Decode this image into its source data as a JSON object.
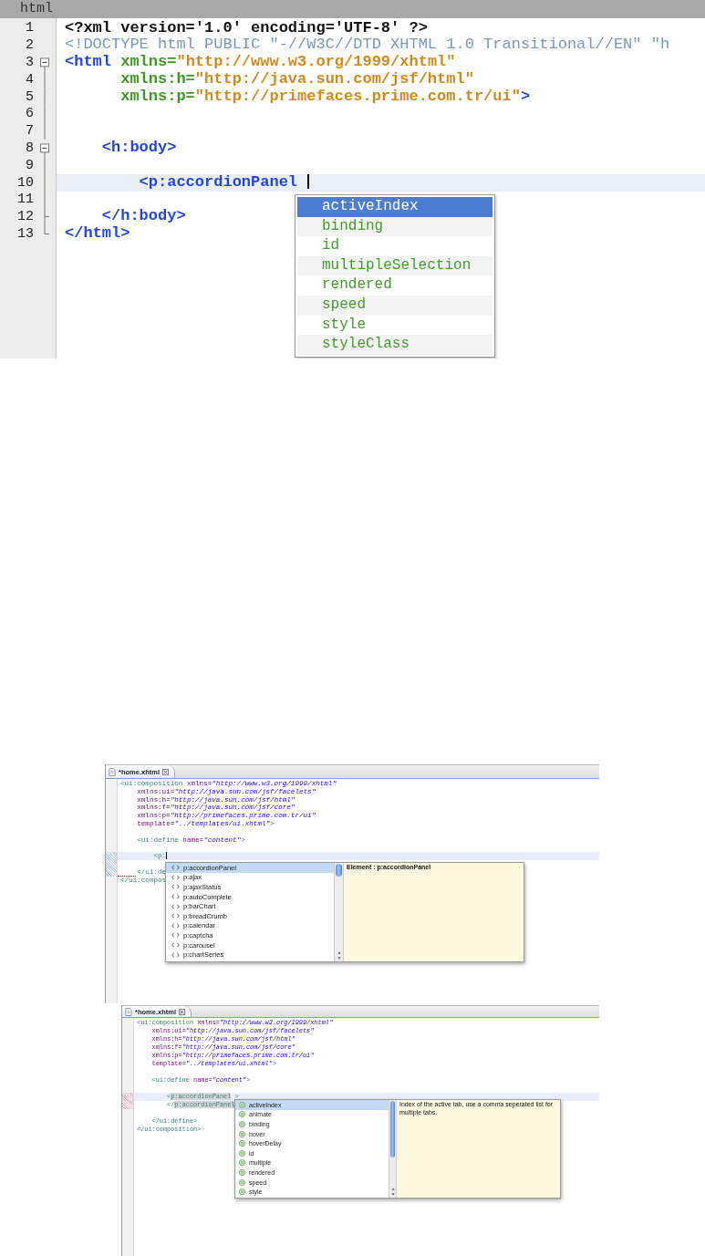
{
  "editors": [
    {
      "kind": "netbeans",
      "title": "html",
      "lines": [
        {
          "number": "1",
          "kind": "plain",
          "current": false,
          "tokens": [
            {
              "kind": "decl",
              "text": "<?xml version='1.0' encoding='UTF-8' ?>"
            }
          ]
        },
        {
          "number": "2",
          "kind": "plain",
          "current": false,
          "tokens": [
            {
              "kind": "doctype",
              "text": "<!DOCTYPE html PUBLIC \"-//W3C//DTD XHTML 1.0 Transitional//EN\" \"h"
            }
          ]
        },
        {
          "number": "3",
          "kind": "fold-start",
          "current": false,
          "tokens": [
            {
              "kind": "tag",
              "text": "<html"
            },
            {
              "kind": "attr",
              "text": " xmlns="
            },
            {
              "kind": "value",
              "text": "\"http://www.w3.org/1999/xhtml\""
            }
          ]
        },
        {
          "number": "4",
          "kind": "fold-line",
          "current": false,
          "tokens": [
            {
              "kind": "attr",
              "text": "      xmlns:h="
            },
            {
              "kind": "value",
              "text": "\"http://java.sun.com/jsf/html\""
            }
          ]
        },
        {
          "number": "5",
          "kind": "fold-line",
          "current": false,
          "tokens": [
            {
              "kind": "attr",
              "text": "      xmlns:p="
            },
            {
              "kind": "value",
              "text": "\"http://primefaces.prime.com.tr/ui\""
            },
            {
              "kind": "tag",
              "text": ">"
            }
          ]
        },
        {
          "number": "6",
          "kind": "fold-line",
          "current": false
        },
        {
          "number": "7",
          "kind": "fold-line",
          "current": false
        },
        {
          "number": "8",
          "kind": "fold-start",
          "current": false,
          "tokens": [
            {
              "kind": "tag",
              "text": "    <h:body>"
            }
          ]
        },
        {
          "number": "9",
          "kind": "fold-line",
          "current": false
        },
        {
          "number": "10",
          "kind": "fold-line",
          "current": true,
          "tokens": [
            {
              "kind": "tag",
              "text": "        <p:accordionPanel"
            },
            {
              "kind": "cursor"
            }
          ]
        },
        {
          "number": "11",
          "kind": "fold-line",
          "current": false
        },
        {
          "number": "12",
          "kind": "fold-tick",
          "current": false,
          "tokens": [
            {
              "kind": "tag",
              "text": "    </h:body>"
            }
          ]
        },
        {
          "number": "13",
          "kind": "fold-end",
          "current": false,
          "tokens": [
            {
              "kind": "tag",
              "text": "</html>"
            }
          ]
        }
      ],
      "popup": {
        "items": [
          {
            "label": "activeIndex",
            "selected": true
          },
          {
            "label": "binding",
            "selected": false
          },
          {
            "label": "id",
            "selected": false
          },
          {
            "label": "multipleSelection",
            "selected": false
          },
          {
            "label": "rendered",
            "selected": false
          },
          {
            "label": "speed",
            "selected": false
          },
          {
            "label": "style",
            "selected": false
          },
          {
            "label": "styleClass",
            "selected": false
          }
        ]
      }
    },
    {
      "kind": "eclipse",
      "tabs": [
        {
          "label": "*home.xhtml",
          "selected": true
        }
      ],
      "lines": [
        {
          "current": false,
          "marked": false,
          "error": false,
          "tokens": [
            {
              "kind": "tag",
              "text": "<ui:composition"
            },
            {
              "kind": "attr",
              "text": " xmlns"
            },
            {
              "kind": "plain",
              "text": "="
            },
            {
              "kind": "value",
              "text": "\"http://www.w3.org/1999/xhtml\""
            }
          ]
        },
        {
          "current": false,
          "marked": false,
          "error": false,
          "tokens": [
            {
              "kind": "attr",
              "text": "    xmlns:ui"
            },
            {
              "kind": "plain",
              "text": "="
            },
            {
              "kind": "value",
              "text": "\"http://java.sun.com/jsf/facelets\""
            }
          ]
        },
        {
          "current": false,
          "marked": false,
          "error": false,
          "tokens": [
            {
              "kind": "attr",
              "text": "    xmlns:h"
            },
            {
              "kind": "plain",
              "text": "="
            },
            {
              "kind": "value",
              "text": "\"http://java.sun.com/jsf/html\""
            }
          ]
        },
        {
          "current": false,
          "marked": false,
          "error": false,
          "tokens": [
            {
              "kind": "attr",
              "text": "    xmlns:f"
            },
            {
              "kind": "plain",
              "text": "="
            },
            {
              "kind": "value",
              "text": "\"http://java.sun.com/jsf/core\""
            }
          ]
        },
        {
          "current": false,
          "marked": false,
          "error": false,
          "tokens": [
            {
              "kind": "attr",
              "text": "    xmlns:p"
            },
            {
              "kind": "plain",
              "text": "="
            },
            {
              "kind": "value",
              "text": "\"http://primefaces.prime.com.tr/ui\""
            }
          ]
        },
        {
          "current": false,
          "marked": false,
          "error": false,
          "tokens": [
            {
              "kind": "attr",
              "text": "    template"
            },
            {
              "kind": "plain",
              "text": "="
            },
            {
              "kind": "value",
              "text": "\"../templates/ui.xhtml\""
            },
            {
              "kind": "tag",
              "text": ">"
            }
          ]
        },
        {
          "current": false,
          "marked": false,
          "error": false
        },
        {
          "current": false,
          "marked": false,
          "error": false,
          "tokens": [
            {
              "kind": "tag",
              "text": "    <ui:define"
            },
            {
              "kind": "attr",
              "text": " name"
            },
            {
              "kind": "plain",
              "text": "="
            },
            {
              "kind": "value",
              "text": "\"content\""
            },
            {
              "kind": "tag",
              "text": ">"
            }
          ]
        },
        {
          "current": false,
          "marked": false,
          "error": false
        },
        {
          "current": true,
          "marked": true,
          "error": false,
          "tokens": [
            {
              "kind": "tag",
              "text": "        <p:"
            },
            {
              "kind": "cursor"
            }
          ]
        },
        {
          "current": false,
          "marked": true,
          "error": false
        },
        {
          "current": false,
          "marked": true,
          "error": true,
          "tokens": [
            {
              "kind": "tag",
              "text": "    </ui:de"
            }
          ]
        },
        {
          "current": false,
          "marked": false,
          "error": false,
          "tokens": [
            {
              "kind": "tag",
              "text": "</ui:compos"
            }
          ]
        }
      ],
      "popup": {
        "description": "Element : p:accordionPanel",
        "items": [
          {
            "label": "p:accordionPanel",
            "kind": "element",
            "selected": true
          },
          {
            "label": "p:ajax",
            "kind": "element",
            "selected": false
          },
          {
            "label": "p:ajaxStatus",
            "kind": "element",
            "selected": false
          },
          {
            "label": "p:autoComplete",
            "kind": "element",
            "selected": false
          },
          {
            "label": "p:barChart",
            "kind": "element",
            "selected": false
          },
          {
            "label": "p:breadCrumb",
            "kind": "element",
            "selected": false
          },
          {
            "label": "p:calendar",
            "kind": "element",
            "selected": false
          },
          {
            "label": "p:captcha",
            "kind": "element",
            "selected": false
          },
          {
            "label": "p:carousel",
            "kind": "element",
            "selected": false
          },
          {
            "label": "p:chartSeries",
            "kind": "element",
            "selected": false
          }
        ]
      }
    },
    {
      "kind": "eclipse",
      "tabs": [
        {
          "label": "*home.xhtml",
          "selected": true
        }
      ],
      "lines": [
        {
          "current": false,
          "marked": false,
          "tokens": [
            {
              "kind": "tag",
              "text": "<ui:composition"
            },
            {
              "kind": "attr",
              "text": " xmlns"
            },
            {
              "kind": "plain",
              "text": "="
            },
            {
              "kind": "value",
              "text": "\"http://www.w3.org/1999/xhtml\""
            }
          ]
        },
        {
          "current": false,
          "marked": false,
          "tokens": [
            {
              "kind": "attr",
              "text": "    xmlns:ui"
            },
            {
              "kind": "plain",
              "text": "="
            },
            {
              "kind": "value",
              "text": "\"http://java.sun.com/jsf/facelets\""
            }
          ]
        },
        {
          "current": false,
          "marked": false,
          "tokens": [
            {
              "kind": "attr",
              "text": "    xmlns:h"
            },
            {
              "kind": "plain",
              "text": "="
            },
            {
              "kind": "value",
              "text": "\"http://java.sun.com/jsf/html\""
            }
          ]
        },
        {
          "current": false,
          "marked": false,
          "tokens": [
            {
              "kind": "attr",
              "text": "    xmlns:f"
            },
            {
              "kind": "plain",
              "text": "="
            },
            {
              "kind": "value",
              "text": "\"http://java.sun.com/jsf/core\""
            }
          ]
        },
        {
          "current": false,
          "marked": false,
          "tokens": [
            {
              "kind": "attr",
              "text": "    xmlns:p"
            },
            {
              "kind": "plain",
              "text": "="
            },
            {
              "kind": "value",
              "text": "\"http://primefaces.prime.com.tr/ui\""
            }
          ]
        },
        {
          "current": false,
          "marked": false,
          "tokens": [
            {
              "kind": "attr",
              "text": "    template"
            },
            {
              "kind": "plain",
              "text": "="
            },
            {
              "kind": "value",
              "text": "\"../templates/ui.xhtml\""
            },
            {
              "kind": "tag",
              "text": ">"
            }
          ]
        },
        {
          "current": false,
          "marked": false
        },
        {
          "current": false,
          "marked": false,
          "tokens": [
            {
              "kind": "tag",
              "text": "    <ui:define"
            },
            {
              "kind": "attr",
              "text": " name"
            },
            {
              "kind": "plain",
              "text": "="
            },
            {
              "kind": "value",
              "text": "\"content\""
            },
            {
              "kind": "tag",
              "text": ">"
            }
          ]
        },
        {
          "current": false,
          "marked": false
        },
        {
          "current": true,
          "marked": true,
          "tokens": [
            {
              "kind": "tag",
              "text": "        <"
            },
            {
              "kind": "occurrence",
              "text": "p:accordionPanel"
            },
            {
              "kind": "tag",
              "text": " >"
            }
          ]
        },
        {
          "current": false,
          "marked": true,
          "tokens": [
            {
              "kind": "tag",
              "text": "        </"
            },
            {
              "kind": "occurrence",
              "text": "p:accordionPanel"
            }
          ]
        },
        {
          "current": false,
          "marked": false
        },
        {
          "current": false,
          "marked": false,
          "tokens": [
            {
              "kind": "tag",
              "text": "    </ui:define>"
            }
          ]
        },
        {
          "current": false,
          "marked": false,
          "tokens": [
            {
              "kind": "tag",
              "text": "</ui:composition>"
            }
          ]
        }
      ],
      "popup": {
        "description": "Index of the active tab, use a comma seperated list for multiple tabs.",
        "items": [
          {
            "label": "activeIndex",
            "kind": "attribute",
            "selected": true
          },
          {
            "label": "animate",
            "kind": "attribute",
            "selected": false
          },
          {
            "label": "binding",
            "kind": "attribute",
            "selected": false
          },
          {
            "label": "hover",
            "kind": "attribute",
            "selected": false
          },
          {
            "label": "hoverDelay",
            "kind": "attribute",
            "selected": false
          },
          {
            "label": "id",
            "kind": "attribute",
            "selected": false
          },
          {
            "label": "multiple",
            "kind": "attribute",
            "selected": false
          },
          {
            "label": "rendered",
            "kind": "attribute",
            "selected": false
          },
          {
            "label": "speed",
            "kind": "attribute",
            "selected": false
          },
          {
            "label": "style",
            "kind": "attribute",
            "selected": false
          }
        ]
      }
    }
  ]
}
